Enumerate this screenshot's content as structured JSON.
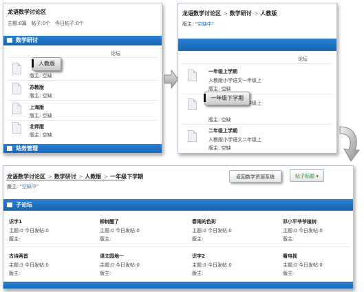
{
  "panel1": {
    "breadcrumb": "龙语数学讨论区",
    "stats": [
      "主题:0篇",
      "帖子:0个",
      "今日帖子:0个"
    ],
    "section_title": "数学研讨",
    "column_header": "论坛",
    "tag": "人教版",
    "forums": [
      {
        "title": "",
        "moderator": "版主: 空缺"
      },
      {
        "title": "苏教版",
        "moderator": "版主: 空缺"
      },
      {
        "title": "上海版",
        "moderator": "版主: 空缺"
      },
      {
        "title": "北师版",
        "moderator": "版主: 空缺"
      }
    ],
    "footer_section": "站务管理"
  },
  "panel2": {
    "breadcrumb": [
      "龙语数学讨论区",
      "数学研讨",
      "人教版"
    ],
    "moderator_label": "版主:",
    "moderator_value": "\"空缺中\"",
    "column_header": "论坛",
    "tag": "一年级下学期",
    "forums": [
      {
        "title": "一年级上学期",
        "desc": "人教版小学语文一年级上",
        "moderator": "版主: 空缺"
      },
      {
        "title": "",
        "desc": "人教版小学语文一年级上",
        "moderator": "版主: 空缺"
      },
      {
        "title": "二年级上学期",
        "desc": "人教版小学语文二年级上",
        "moderator": "版主: 空缺"
      }
    ]
  },
  "panel3": {
    "breadcrumb": [
      "龙语数学讨论区",
      "数学研讨",
      "人教版",
      "一年级下学期"
    ],
    "moderator_label": "版主:",
    "moderator_value": "\"空缺中\"",
    "return_button": "返回数学资源系统",
    "topic_button": "帖子标题",
    "section_title": "子论坛",
    "cells": [
      {
        "title": "识字1",
        "stats": "主题:0 今日发帖:0",
        "moderator": "版主:"
      },
      {
        "title": "柳树醒了",
        "stats": "主题:0 今日发帖:0",
        "moderator": "版主:"
      },
      {
        "title": "春雨的色彩",
        "stats": "主题:0 今日发帖:0",
        "moderator": "版主:"
      },
      {
        "title": "邓小平爷爷植树",
        "stats": "主题:0 今日发帖:0",
        "moderator": "版主:"
      },
      {
        "title": "古诗两首",
        "stats": "主题:0 今日发帖:0",
        "moderator": "版主:"
      },
      {
        "title": "语文园地一",
        "stats": "主题:0 今日发帖:0",
        "moderator": "版主:"
      },
      {
        "title": "识字2",
        "stats": "主题:0 今日发帖:0",
        "moderator": "版主:"
      },
      {
        "title": "看电视",
        "stats": "主题:0 今日发帖:0",
        "moderator": "版主:"
      }
    ]
  },
  "colors": {
    "accent": "#1766b7",
    "link": "#2a6fb5"
  }
}
